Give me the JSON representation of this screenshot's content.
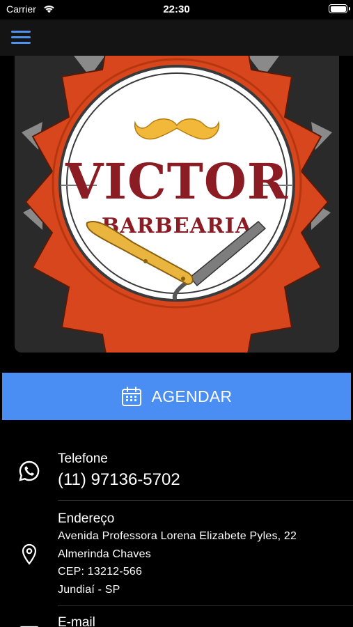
{
  "status_bar": {
    "carrier": "Carrier",
    "time": "22:30"
  },
  "nav": {
    "menu_icon": "hamburger-menu-icon",
    "accent_color": "#4f93ee"
  },
  "logo": {
    "name_line1": "VICTOR",
    "name_line2": "BARBEARIA"
  },
  "agendar_button": {
    "label": "AGENDAR",
    "icon": "calendar-icon",
    "color": "#4b8ef3"
  },
  "contact": {
    "phone": {
      "icon": "whatsapp-icon",
      "title": "Telefone",
      "value": "(11) 97136-5702"
    },
    "address": {
      "icon": "location-pin-icon",
      "title": "Endereço",
      "lines": [
        "Avenida Professora Lorena Elizabete Pyles, 22",
        "Almerinda Chaves",
        "CEP: 13212-566",
        "Jundiaí - SP"
      ]
    },
    "email": {
      "icon": "mail-icon",
      "title": "E-mail"
    }
  }
}
